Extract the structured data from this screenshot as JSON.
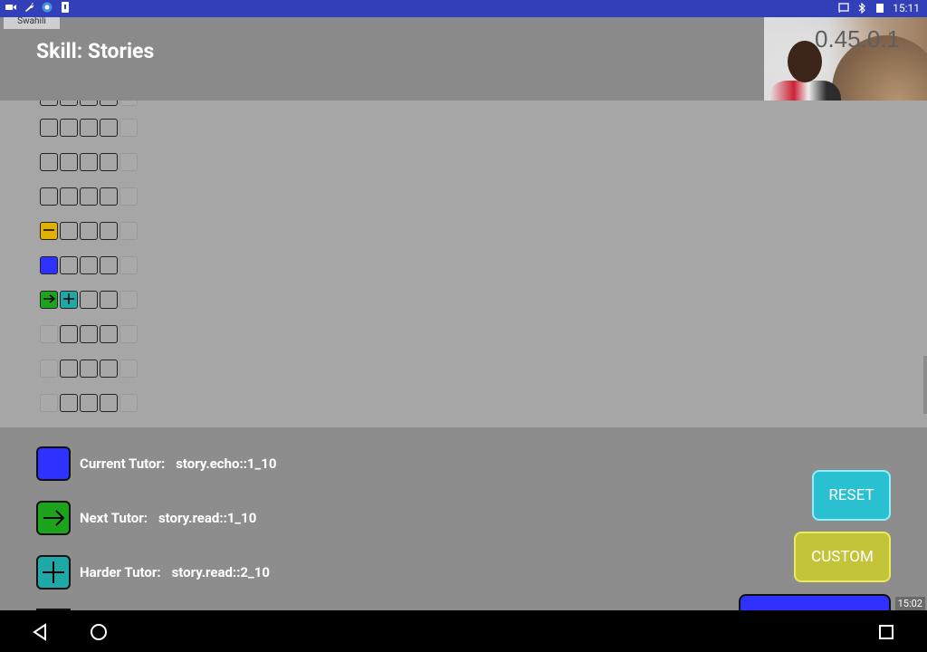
{
  "status_bar": {
    "time": "15:11",
    "left_icons": [
      "video-icon",
      "wrench-icon",
      "chrome-icon",
      "download-icon"
    ],
    "right_icons": [
      "cast-icon",
      "bluetooth-icon",
      "battery-icon"
    ]
  },
  "language_tab": "Swahili",
  "header": {
    "title": "Skill: Stories"
  },
  "camera": {
    "version": "0.45.0.1"
  },
  "grid": {
    "rows": [
      [
        "empty",
        "empty",
        "empty",
        "empty",
        "faded"
      ],
      [
        "empty",
        "empty",
        "empty",
        "empty",
        "faded"
      ],
      [
        "empty",
        "empty",
        "empty",
        "empty",
        "faded"
      ],
      [
        "yellow",
        "empty",
        "empty",
        "empty",
        "faded"
      ],
      [
        "blue",
        "empty",
        "empty",
        "empty",
        "faded"
      ],
      [
        "green",
        "teal",
        "empty",
        "empty",
        "faded"
      ],
      [
        "faded",
        "empty",
        "empty",
        "empty",
        "faded"
      ],
      [
        "faded",
        "empty",
        "empty",
        "empty",
        "faded"
      ],
      [
        "faded",
        "empty",
        "empty",
        "empty",
        "faded"
      ]
    ]
  },
  "tutors": {
    "current": {
      "label": "Current Tutor:",
      "value": "story.echo::1_10",
      "color": "#2f31ff"
    },
    "next": {
      "label": "Next Tutor:",
      "value": "story.read::1_10",
      "color": "#1da41d"
    },
    "harder": {
      "label": "Harder Tutor:",
      "value": "story.read::2_10",
      "color": "#1fa8a8"
    }
  },
  "buttons": {
    "reset": "RESET",
    "custom": "CUSTOM"
  },
  "overlay_time": "15:02",
  "nav": [
    "back-icon",
    "home-icon",
    "recents-icon"
  ]
}
